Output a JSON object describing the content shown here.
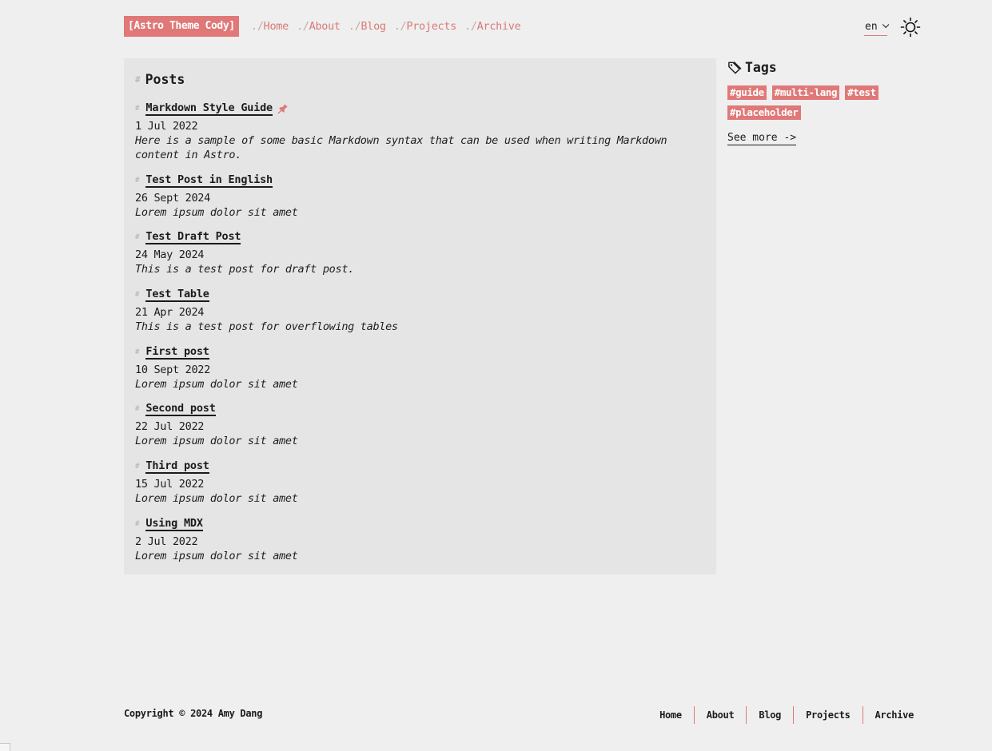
{
  "header": {
    "logo": "[Astro Theme Cody]",
    "nav": [
      {
        "prefix": "./",
        "label": "Home"
      },
      {
        "prefix": "./",
        "label": "About"
      },
      {
        "prefix": "./",
        "label": "Blog"
      },
      {
        "prefix": "./",
        "label": "Projects"
      },
      {
        "prefix": "./",
        "label": "Archive"
      }
    ],
    "language": "en",
    "theme_toggle_icon": "sun-icon"
  },
  "posts": {
    "heading": "Posts",
    "heading_marker": "#",
    "items": [
      {
        "title": "Markdown Style Guide",
        "pinned": true,
        "date": "1 Jul 2022",
        "description": "Here is a sample of some basic Markdown syntax that can be used when writing Markdown content in Astro."
      },
      {
        "title": "Test Post in English",
        "pinned": false,
        "date": "26 Sept 2024",
        "description": "Lorem ipsum dolor sit amet"
      },
      {
        "title": "Test Draft Post",
        "pinned": false,
        "date": "24 May 2024",
        "description": "This is a test post for draft post."
      },
      {
        "title": "Test Table",
        "pinned": false,
        "date": "21 Apr 2024",
        "description": "This is a test post for overflowing tables"
      },
      {
        "title": "First post",
        "pinned": false,
        "date": "10 Sept 2022",
        "description": "Lorem ipsum dolor sit amet"
      },
      {
        "title": "Second post",
        "pinned": false,
        "date": "22 Jul 2022",
        "description": "Lorem ipsum dolor sit amet"
      },
      {
        "title": "Third post",
        "pinned": false,
        "date": "15 Jul 2022",
        "description": "Lorem ipsum dolor sit amet"
      },
      {
        "title": "Using MDX",
        "pinned": false,
        "date": "2 Jul 2022",
        "description": "Lorem ipsum dolor sit amet"
      }
    ]
  },
  "sidebar": {
    "tags_heading": "Tags",
    "tags": [
      "#guide",
      "#multi-lang",
      "#test",
      "#placeholder"
    ],
    "see_more": "See more ->"
  },
  "footer": {
    "copyright": "Copyright © 2024 Amy Dang",
    "links": [
      "Home",
      "About",
      "Blog",
      "Projects",
      "Archive"
    ]
  },
  "colors": {
    "accent": "#e07878",
    "background": "#efefef",
    "panel": "#e5e5e5",
    "text": "#1b1b1b"
  }
}
